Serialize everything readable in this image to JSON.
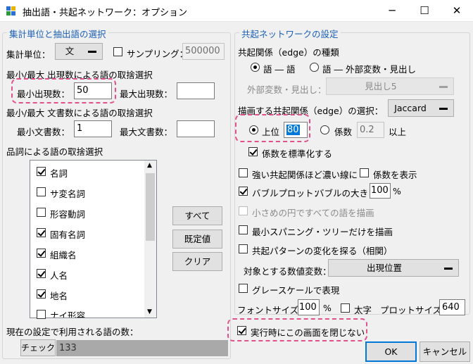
{
  "window": {
    "title": "抽出語・共起ネットワーク：オプション",
    "minimize": "─",
    "maximize": "☐",
    "close": "✕"
  },
  "left": {
    "group_title": "集計単位と抽出語の選択",
    "unit_label": "集計単位：",
    "unit_value": "文",
    "sampling_label": "サンプリング：",
    "sampling_value": "500000",
    "freq_heading": "最小/最大 出現数による語の取捨選択",
    "min_freq_label": "最小出現数：",
    "min_freq_value": "50",
    "max_freq_label": "最大出現数：",
    "max_freq_value": "",
    "doc_heading": "最小/最大 文書数による語の取捨選択",
    "min_doc_label": "最小文書数：",
    "min_doc_value": "1",
    "max_doc_label": "最大文書数：",
    "max_doc_value": "",
    "pos_heading": "品詞による語の取捨選択",
    "pos_items": [
      {
        "label": "名詞",
        "checked": true
      },
      {
        "label": "サ変名詞",
        "checked": false
      },
      {
        "label": "形容動詞",
        "checked": false
      },
      {
        "label": "固有名詞",
        "checked": true
      },
      {
        "label": "組織名",
        "checked": true
      },
      {
        "label": "人名",
        "checked": true
      },
      {
        "label": "地名",
        "checked": true
      },
      {
        "label": "ナイ形容",
        "checked": false
      }
    ],
    "btn_all": "すべて",
    "btn_default": "既定値",
    "btn_clear": "クリア",
    "current_count_label": "現在の設定で利用される語の数：",
    "check_button": "チェック",
    "count_value": "133"
  },
  "right": {
    "group_title": "共起ネットワークの設定",
    "edge_kind_label": "共起関係（edge）の種類",
    "radio_word_word": "語 ― 語",
    "radio_word_ext": "語 ― 外部変数・見出し",
    "ext_label": "外部変数・見出し：",
    "ext_value": "見出し5",
    "edge_select_label": "描画する共起関係（edge）の選択：",
    "measure_value": "Jaccard",
    "top_label": "上位",
    "top_value": "80",
    "coef_label": "係数",
    "coef_value": "0.2",
    "coef_suffix": "以上",
    "standardize_label": "係数を標準化する",
    "strong_label": "強い共起関係ほど濃い線に",
    "show_coef_label": "係数を表示",
    "bubble_label": "バブルプロット：",
    "bubble_size_label": "バブルの大きさ",
    "bubble_size_value": "100",
    "bubble_unit": "%",
    "small_circle_label": "小さめの円ですべての語を描画",
    "mst_label": "最小スパニング・ツリーだけを描画",
    "pattern_label": "共起パターンの変化を探る（相関）",
    "target_var_label": "対象とする数値変数：",
    "target_var_value": "出現位置",
    "grayscale_label": "グレースケールで表現",
    "font_size_label": "フォントサイズ：",
    "font_size_value": "100",
    "font_unit": "%",
    "bold_label": "太字",
    "plot_size_label": "プロットサイズ：",
    "plot_size_value": "640"
  },
  "footer": {
    "keep_open_label": "実行時にこの画面を閉じない",
    "ok": "OK",
    "cancel": "キャンセル"
  },
  "colors": {
    "accent": "#1a5fb4",
    "highlight": "#e0528c",
    "selection": "#0078d7"
  }
}
